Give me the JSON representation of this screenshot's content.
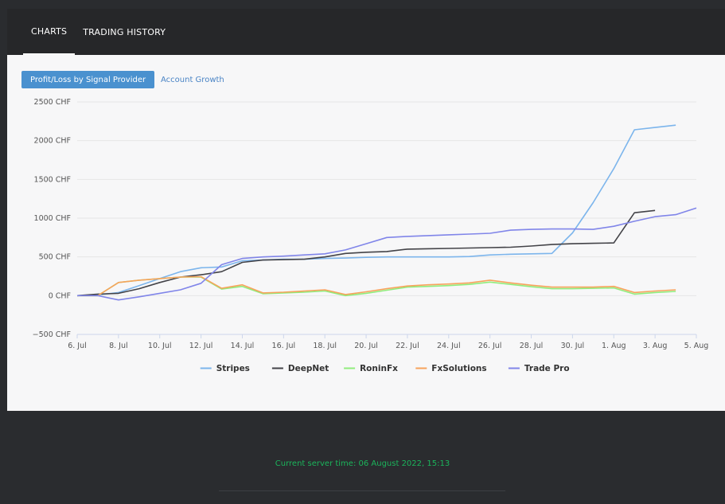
{
  "tabs": [
    {
      "label": "CHARTS"
    },
    {
      "label": "TRADING HISTORY"
    }
  ],
  "chart_tabs": [
    {
      "label": "Profit/Loss by Signal Provider"
    },
    {
      "label": "Account Growth"
    }
  ],
  "footer": {
    "server_time": "Current server time: 06 August 2022, 15:13"
  },
  "colors": {
    "Stripes": "#7cb5ec",
    "DeepNet": "#434348",
    "RoninFx": "#90ed7d",
    "FxSolutions": "#f7a35c",
    "Trade Pro": "#8085e9"
  },
  "chart_data": {
    "type": "line",
    "title": "",
    "xlabel": "",
    "ylabel": "",
    "ylim": [
      -500,
      2500
    ],
    "yticks": [
      2500,
      2000,
      1500,
      1000,
      500,
      0,
      -500
    ],
    "ytick_labels": [
      "2500 CHF",
      "2000 CHF",
      "1500 CHF",
      "1000 CHF",
      "500 CHF",
      "0 CHF",
      "−500 CHF"
    ],
    "xdays": [
      6,
      36
    ],
    "xticks": [
      6,
      8,
      10,
      12,
      14,
      16,
      18,
      20,
      22,
      24,
      26,
      28,
      30,
      32,
      34,
      36
    ],
    "xtick_labels": [
      "6. Jul",
      "8. Jul",
      "10. Jul",
      "12. Jul",
      "14. Jul",
      "16. Jul",
      "18. Jul",
      "20. Jul",
      "22. Jul",
      "24. Jul",
      "26. Jul",
      "28. Jul",
      "30. Jul",
      "1. Aug",
      "3. Aug",
      "5. Aug"
    ],
    "grid": true,
    "legend": "bottom",
    "series": [
      {
        "name": "Stripes",
        "color": "#7cb5ec",
        "x": [
          6,
          7,
          8,
          9,
          10,
          11,
          12,
          13,
          14,
          15,
          16,
          17,
          18,
          19,
          20,
          21,
          22,
          23,
          24,
          25,
          26,
          27,
          28,
          29,
          30,
          31,
          32,
          33,
          34,
          35
        ],
        "values": [
          0,
          10,
          40,
          130,
          220,
          310,
          360,
          370,
          450,
          460,
          470,
          470,
          480,
          485,
          495,
          500,
          500,
          500,
          500,
          505,
          525,
          535,
          540,
          545,
          810,
          1200,
          1640,
          2140,
          2170,
          2200
        ]
      },
      {
        "name": "DeepNet",
        "color": "#434348",
        "x": [
          6,
          7,
          8,
          9,
          10,
          11,
          12,
          13,
          14,
          15,
          16,
          17,
          18,
          19,
          20,
          21,
          22,
          23,
          24,
          25,
          26,
          27,
          28,
          29,
          30,
          31,
          32,
          33,
          34
        ],
        "values": [
          0,
          20,
          30,
          90,
          170,
          240,
          270,
          310,
          430,
          460,
          465,
          470,
          500,
          545,
          560,
          570,
          600,
          605,
          610,
          615,
          620,
          625,
          640,
          660,
          670,
          675,
          680,
          1070,
          1100
        ]
      },
      {
        "name": "RoninFx",
        "color": "#90ed7d",
        "x": [
          6,
          7,
          8,
          9,
          10,
          11,
          12,
          13,
          14,
          15,
          16,
          17,
          18,
          19,
          20,
          21,
          22,
          23,
          24,
          25,
          26,
          27,
          28,
          29,
          30,
          31,
          32,
          33,
          34,
          35
        ],
        "values": [
          0,
          0,
          170,
          200,
          220,
          240,
          240,
          85,
          120,
          25,
          35,
          45,
          60,
          0,
          30,
          70,
          110,
          120,
          130,
          145,
          175,
          145,
          115,
          90,
          90,
          95,
          100,
          20,
          40,
          55
        ]
      },
      {
        "name": "FxSolutions",
        "color": "#f7a35c",
        "x": [
          6,
          7,
          8,
          9,
          10,
          11,
          12,
          13,
          14,
          15,
          16,
          17,
          18,
          19,
          20,
          21,
          22,
          23,
          24,
          25,
          26,
          27,
          28,
          29,
          30,
          31,
          32,
          33,
          34,
          35
        ],
        "values": [
          0,
          0,
          170,
          200,
          220,
          240,
          245,
          95,
          140,
          35,
          45,
          60,
          75,
          15,
          50,
          90,
          125,
          140,
          150,
          165,
          200,
          165,
          135,
          110,
          110,
          110,
          120,
          40,
          60,
          75
        ]
      },
      {
        "name": "Trade Pro",
        "color": "#8085e9",
        "x": [
          6,
          7,
          8,
          9,
          10,
          11,
          12,
          13,
          14,
          15,
          16,
          17,
          18,
          19,
          20,
          21,
          22,
          23,
          24,
          25,
          26,
          27,
          28,
          29,
          30,
          31,
          32,
          33,
          34,
          35,
          36
        ],
        "values": [
          0,
          0,
          -55,
          -15,
          30,
          75,
          160,
          400,
          480,
          500,
          510,
          525,
          540,
          590,
          670,
          750,
          765,
          775,
          785,
          795,
          805,
          845,
          855,
          860,
          860,
          855,
          895,
          960,
          1020,
          1045,
          1130
        ]
      }
    ]
  }
}
